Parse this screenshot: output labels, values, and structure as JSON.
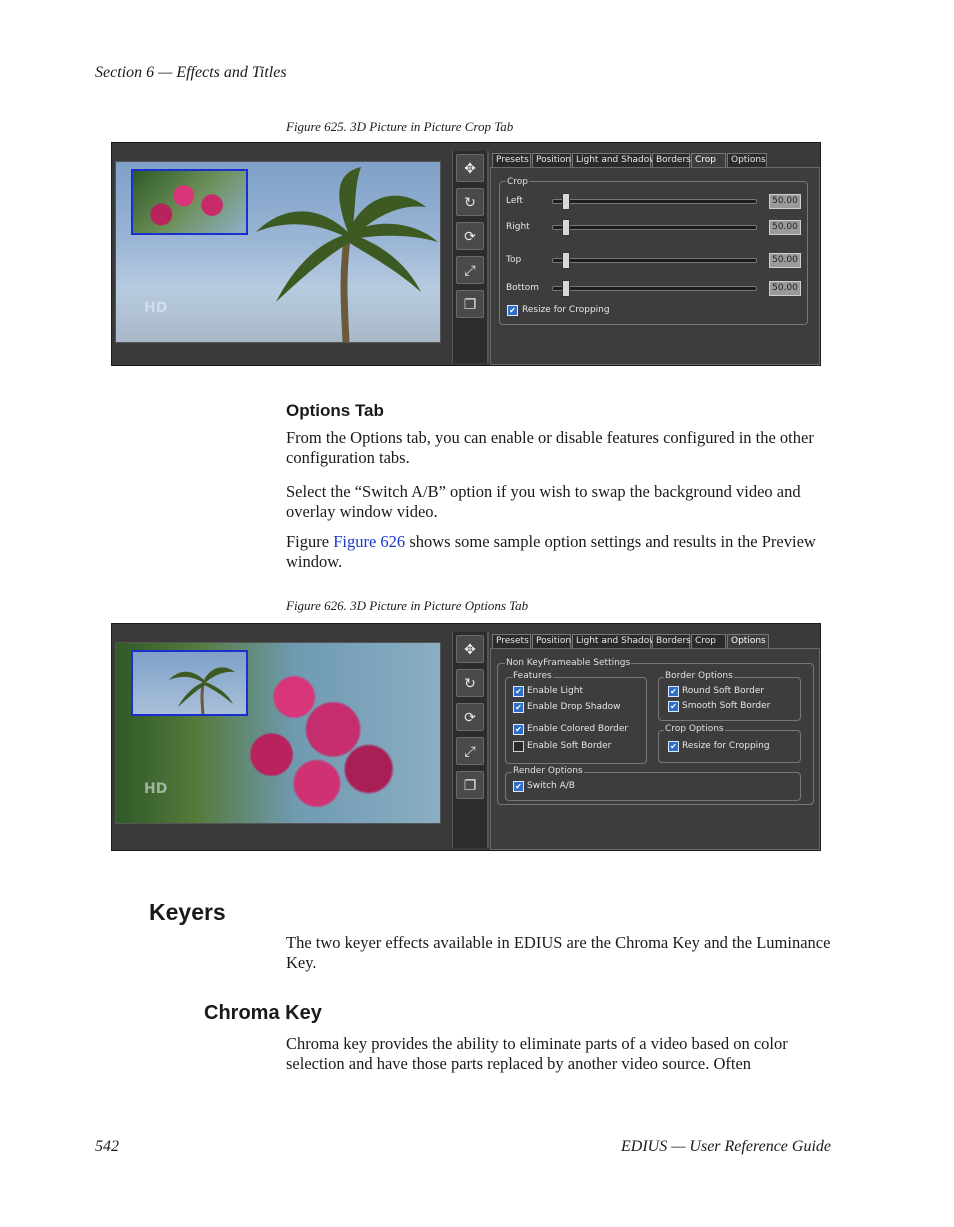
{
  "header": {
    "section": "Section 6 — Effects and Titles"
  },
  "figure625": {
    "caption": "Figure 625.  3D Picture in Picture Crop Tab",
    "tabs": [
      "Presets",
      "Position",
      "Light and Shadow",
      "Borders",
      "Crop",
      "Options"
    ],
    "active_tab": "Crop",
    "group_label": "Crop",
    "sliders": [
      {
        "label": "Left",
        "value": "50.00",
        "level": 0.0
      },
      {
        "label": "Right",
        "value": "50.00",
        "level": 0.0
      },
      {
        "label": "Top",
        "value": "50.00",
        "level": 0.0
      },
      {
        "label": "Bottom",
        "value": "50.00",
        "level": 0.0
      }
    ],
    "checkbox": {
      "label": "Resize for Cropping",
      "checked": true
    },
    "logo": "HD"
  },
  "options_tab": {
    "heading": "Options Tab",
    "para1": "From the Options tab, you can enable or disable features configured in the other configuration tabs.",
    "para2": "Select the “Switch A/B” option if you wish to swap the background video and overlay window video.",
    "para3_prefix": "Figure ",
    "para3_link": "Figure 626",
    "para3_suffix": " shows some sample option settings and results in the Preview window."
  },
  "figure626": {
    "caption": "Figure 626.  3D Picture in Picture Options Tab",
    "tabs": [
      "Presets",
      "Position",
      "Light and Shadow",
      "Borders",
      "Crop",
      "Options"
    ],
    "active_tab": "Options",
    "outer_group": "Non KeyFrameable Settings",
    "features_label": "Features",
    "features": [
      {
        "label": "Enable Light",
        "checked": true
      },
      {
        "label": "Enable Drop Shadow",
        "checked": true
      },
      {
        "label": "Enable Colored Border",
        "checked": true
      },
      {
        "label": "Enable Soft Border",
        "checked": false
      }
    ],
    "border_options_label": "Border Options",
    "border_options": [
      {
        "label": "Round Soft Border",
        "checked": true
      },
      {
        "label": "Smooth Soft Border",
        "checked": true
      }
    ],
    "crop_options_label": "Crop Options",
    "crop_options": [
      {
        "label": "Resize for Cropping",
        "checked": true
      }
    ],
    "render_options_label": "Render Options",
    "render_options": [
      {
        "label": "Switch  A/B",
        "checked": true
      }
    ],
    "logo": "HD"
  },
  "keyers": {
    "heading": "Keyers",
    "para": "The two keyer effects available in EDIUS are the Chroma Key and the Luminance Key."
  },
  "chroma_key": {
    "heading": "Chroma Key",
    "para": "Chroma key provides the ability to eliminate parts of a video based on color selection and have those parts replaced by another video source. Often"
  },
  "footer": {
    "page_number": "542",
    "guide": "EDIUS  —  User Reference Guide"
  },
  "icons": [
    "move-icon",
    "rotate-icon",
    "spin-icon",
    "scale-icon",
    "shadow-icon"
  ],
  "colors": {
    "link": "#1a39c9",
    "panel": "#3a3a3a",
    "checkbox_on": "#2f6fc8",
    "overlay_border": "#1a2fd0"
  }
}
